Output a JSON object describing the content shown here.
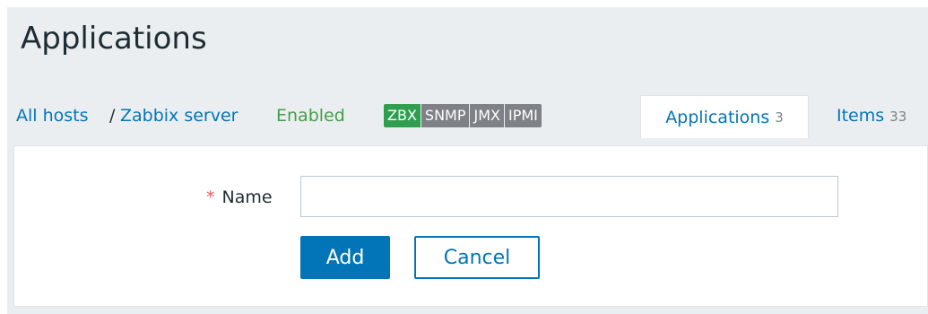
{
  "page": {
    "title": "Applications"
  },
  "breadcrumb": {
    "all_hosts": "All hosts",
    "separator": "/",
    "host": "Zabbix server",
    "status": "Enabled"
  },
  "availability": {
    "zbx": "ZBX",
    "snmp": "SNMP",
    "jmx": "JMX",
    "ipmi": "IPMI",
    "colors": {
      "available": "#2f9f4f",
      "unknown": "#7e8286"
    }
  },
  "tabs": {
    "applications": {
      "label": "Applications",
      "count": "3"
    },
    "items": {
      "label": "Items",
      "count": "33"
    }
  },
  "form": {
    "name_required": "*",
    "name_label": "Name",
    "name_value": "",
    "add_label": "Add",
    "cancel_label": "Cancel"
  },
  "colors": {
    "link": "#0275b8",
    "status_enabled": "#429e47",
    "required": "#e45959",
    "background": "#ebeef0"
  }
}
